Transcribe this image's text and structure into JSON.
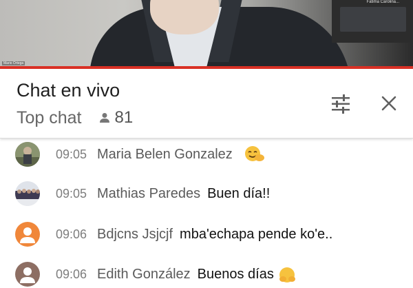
{
  "video": {
    "thumbnail_name": "Fatima Carolina...",
    "speaker_name": "Mario Ortega"
  },
  "chat": {
    "title": "Chat en vivo",
    "mode": "Top chat",
    "viewer_count": "81",
    "settings_icon": "tune-icon",
    "close_icon": "close-icon"
  },
  "messages": [
    {
      "time": "09:05",
      "author": "Maria Belen Gonzalez",
      "text": "",
      "emoji": "smiling-face-with-hands-icon",
      "avatar": "photo-avatar"
    },
    {
      "time": "09:05",
      "author": "Mathias Paredes",
      "text": "Buen día!!",
      "avatar": "group-photo-avatar"
    },
    {
      "time": "09:06",
      "author": "Bdjcns Jsjcjf",
      "text": "mba'echapa pende ko'e..",
      "avatar": "default-orange-avatar"
    },
    {
      "time": "09:06",
      "author": "Edith González",
      "text": "Buenos días",
      "emoji": "hugging-face-icon",
      "avatar": "default-brown-avatar"
    }
  ],
  "colors": {
    "accent_red": "#d93025",
    "default_avatar_orange": "#f0873a",
    "default_avatar_brown": "#8d6e63"
  }
}
